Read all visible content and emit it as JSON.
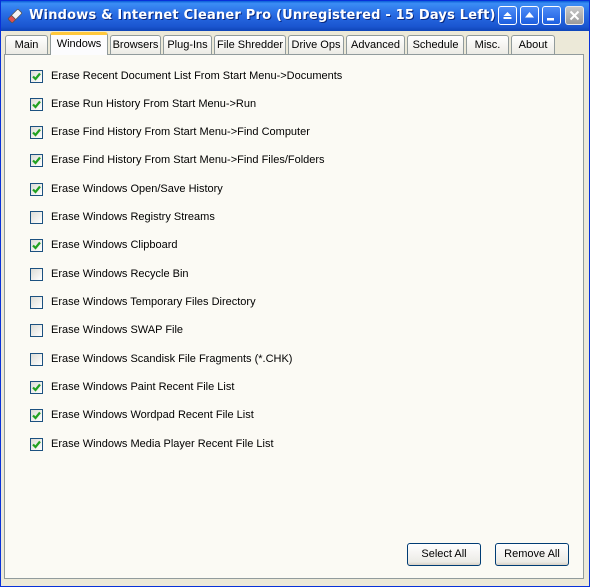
{
  "window": {
    "title": "Windows & Internet Cleaner Pro (Unregistered - 15 Days Left)",
    "icons": {
      "app": "eraser-icon",
      "buttons": [
        "rollup-icon",
        "expand-icon",
        "minimize-icon",
        "close-icon"
      ]
    }
  },
  "tabs": [
    {
      "label": "Main"
    },
    {
      "label": "Windows",
      "active": true
    },
    {
      "label": "Browsers"
    },
    {
      "label": "Plug-Ins"
    },
    {
      "label": "File Shredder"
    },
    {
      "label": "Drive Ops"
    },
    {
      "label": "Advanced"
    },
    {
      "label": "Schedule"
    },
    {
      "label": "Misc."
    },
    {
      "label": "About"
    }
  ],
  "options": [
    {
      "label": "Erase Recent Document List From Start Menu->Documents",
      "checked": true
    },
    {
      "label": "Erase Run History From Start Menu->Run",
      "checked": true
    },
    {
      "label": "Erase Find History From Start Menu->Find Computer",
      "checked": true
    },
    {
      "label": "Erase Find History From Start Menu->Find Files/Folders",
      "checked": true
    },
    {
      "label": "Erase Windows Open/Save History",
      "checked": true
    },
    {
      "label": "Erase Windows Registry Streams",
      "checked": false
    },
    {
      "label": "Erase Windows Clipboard",
      "checked": true
    },
    {
      "label": "Erase Windows Recycle Bin",
      "checked": false
    },
    {
      "label": "Erase Windows Temporary Files Directory",
      "checked": false
    },
    {
      "label": "Erase Windows SWAP File",
      "checked": false
    },
    {
      "label": "Erase Windows Scandisk File Fragments (*.CHK)",
      "checked": false
    },
    {
      "label": "Erase Windows Paint Recent File List",
      "checked": true
    },
    {
      "label": "Erase Windows Wordpad Recent File List",
      "checked": true
    },
    {
      "label": "Erase Windows Media Player Recent File List",
      "checked": true
    }
  ],
  "buttons": {
    "select_all": "Select All",
    "remove_all": "Remove All"
  },
  "colors": {
    "title_bar": "#1a55d0",
    "active_tab_accent": "#ffc83c",
    "window_bg": "#ece9d8",
    "checkmark": "#21a121"
  }
}
